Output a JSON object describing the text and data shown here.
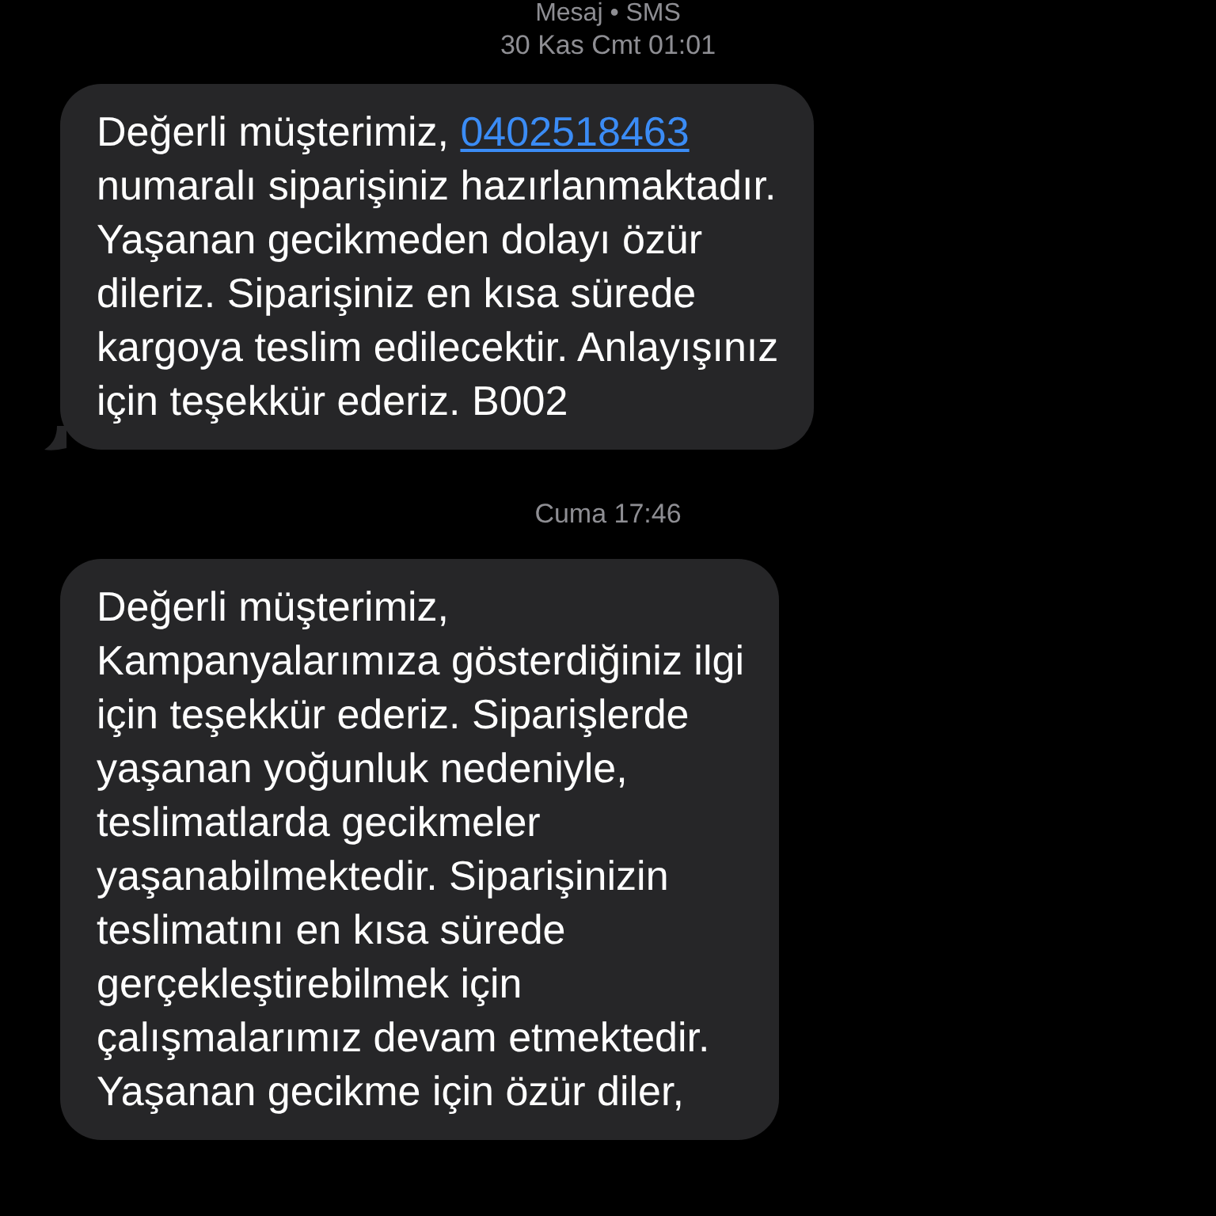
{
  "header": {
    "title": "Mesaj • SMS",
    "time": "30 Kas Cmt 01:01"
  },
  "messages": [
    {
      "tail": true,
      "segments": [
        {
          "kind": "text",
          "text": "Değerli müşterimiz, "
        },
        {
          "kind": "link",
          "text": "0402518463"
        },
        {
          "kind": "text",
          "text": "\nnumaralı siparişiniz hazırlanmaktadır.\nYaşanan gecikmeden dolayı özür\ndileriz. Siparişiniz en kısa sürede\nkargoya teslim edilecektir. Anlayışınız\niçin teşekkür ederiz. B002"
        }
      ]
    },
    {
      "time": "Cuma 17:46",
      "tail": false,
      "segments": [
        {
          "kind": "text",
          "text": "Değerli müşterimiz,\nKampanyalarımıza gösterdiğiniz ilgi\niçin teşekkür ederiz. Siparişlerde\nyaşanan yoğunluk nedeniyle,\nteslimatlarda gecikmeler\nyaşanabilmektedir. Siparişinizin\nteslimatını en kısa sürede\ngerçekleştirebilmek için\nçalışmalarımız devam etmektedir.\nYaşanan gecikme için özür diler,"
        }
      ]
    }
  ]
}
